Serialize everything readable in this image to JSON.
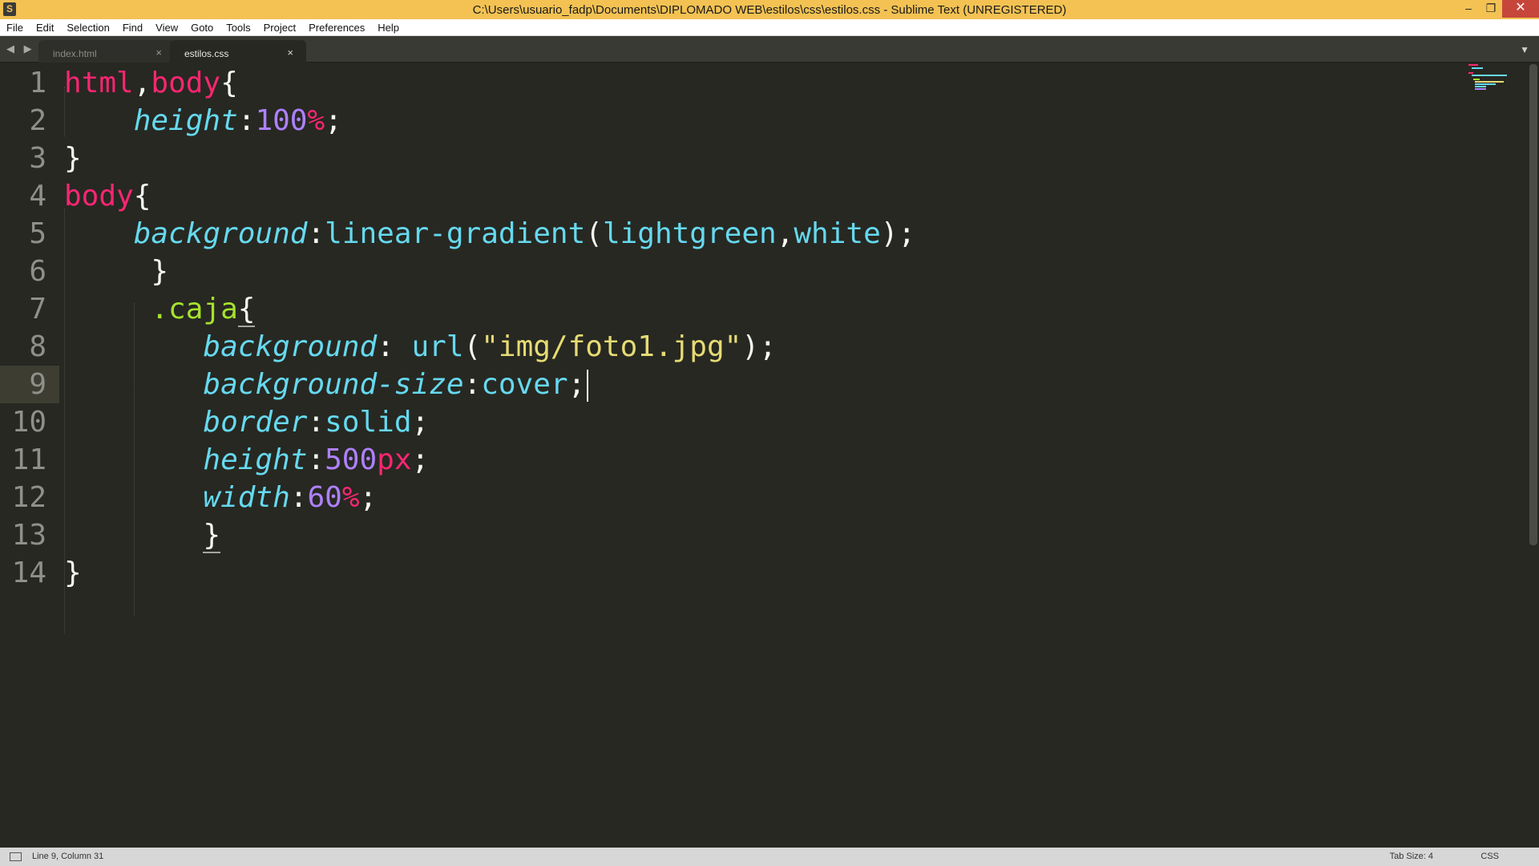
{
  "window": {
    "title": "C:\\Users\\usuario_fadp\\Documents\\DIPLOMADO WEB\\estilos\\css\\estilos.css - Sublime Text (UNREGISTERED)",
    "app_icon": "sublime-icon",
    "controls": {
      "minimize": "–",
      "restore": "❐",
      "close": "✕"
    }
  },
  "menu": [
    "File",
    "Edit",
    "Selection",
    "Find",
    "View",
    "Goto",
    "Tools",
    "Project",
    "Preferences",
    "Help"
  ],
  "tabs": [
    {
      "label": "index.html",
      "active": false,
      "close": "×"
    },
    {
      "label": "estilos.css",
      "active": true,
      "close": "×"
    }
  ],
  "tab_nav": "◀ ▶",
  "tab_dropdown": "▼",
  "editor": {
    "line_numbers": [
      "1",
      "2",
      "3",
      "4",
      "5",
      "6",
      "7",
      "8",
      "9",
      "10",
      "11",
      "12",
      "13",
      "14"
    ],
    "current_line": 9,
    "lines": [
      [
        [
          "sel",
          "html"
        ],
        [
          "pun",
          ","
        ],
        [
          "sel",
          "body"
        ],
        [
          "pun",
          "{"
        ]
      ],
      [
        [
          "ws",
          "    "
        ],
        [
          "prop",
          "height"
        ],
        [
          "pun",
          ":"
        ],
        [
          "num",
          "100"
        ],
        [
          "unit",
          "%"
        ],
        [
          "pun",
          ";"
        ]
      ],
      [
        [
          "pun",
          "}"
        ]
      ],
      [
        [
          "sel",
          "body"
        ],
        [
          "pun",
          "{"
        ]
      ],
      [
        [
          "ws",
          "    "
        ],
        [
          "prop",
          "background"
        ],
        [
          "pun",
          ":"
        ],
        [
          "val",
          "linear-gradient"
        ],
        [
          "pun",
          "("
        ],
        [
          "val",
          "lightgreen"
        ],
        [
          "pun",
          ","
        ],
        [
          "val",
          "white"
        ],
        [
          "pun",
          ");"
        ]
      ],
      [
        [
          "ws",
          "     "
        ],
        [
          "pun",
          "}"
        ]
      ],
      [
        [
          "ws",
          "     "
        ],
        [
          "cls",
          ".caja"
        ],
        [
          "ul",
          "{"
        ]
      ],
      [
        [
          "ws",
          "        "
        ],
        [
          "prop",
          "background"
        ],
        [
          "pun",
          ": "
        ],
        [
          "val",
          "url"
        ],
        [
          "pun",
          "("
        ],
        [
          "str",
          "\"img/foto1.jpg\""
        ],
        [
          "pun",
          ");"
        ]
      ],
      [
        [
          "ws",
          "        "
        ],
        [
          "prop",
          "background-size"
        ],
        [
          "pun",
          ":"
        ],
        [
          "val",
          "cover"
        ],
        [
          "pun",
          ";"
        ],
        [
          "cursor",
          ""
        ]
      ],
      [
        [
          "ws",
          "        "
        ],
        [
          "prop",
          "border"
        ],
        [
          "pun",
          ":"
        ],
        [
          "val",
          "solid"
        ],
        [
          "pun",
          ";"
        ]
      ],
      [
        [
          "ws",
          "        "
        ],
        [
          "prop",
          "height"
        ],
        [
          "pun",
          ":"
        ],
        [
          "num",
          "500"
        ],
        [
          "unit",
          "px"
        ],
        [
          "pun",
          ";"
        ]
      ],
      [
        [
          "ws",
          "        "
        ],
        [
          "prop",
          "width"
        ],
        [
          "pun",
          ":"
        ],
        [
          "num",
          "60"
        ],
        [
          "unit",
          "%"
        ],
        [
          "pun",
          ";"
        ]
      ],
      [
        [
          "ws",
          "        "
        ],
        [
          "ul",
          "}"
        ]
      ],
      [
        [
          "pun",
          "}"
        ]
      ]
    ]
  },
  "status": {
    "position": "Line 9, Column 31",
    "tab_size": "Tab Size: 4",
    "syntax": "CSS"
  },
  "colors": {
    "titlebar": "#f3c253",
    "editor_bg": "#272822",
    "selector": "#f92672",
    "property": "#66d9ef",
    "number": "#ae81ff",
    "class": "#a6e22e",
    "string": "#e6db74"
  }
}
